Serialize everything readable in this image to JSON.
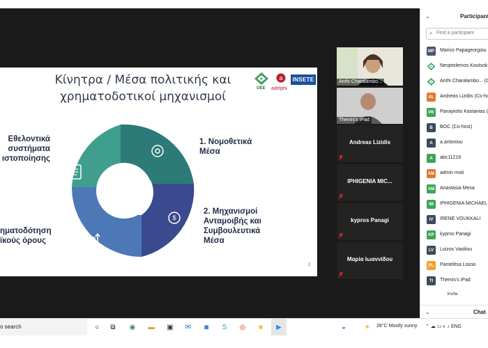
{
  "slide": {
    "title_line1": "Κίνητρα / Μέσα πολιτικής και",
    "title_line2": "χρηματοδοτικοί μηχανισμοί",
    "logos": {
      "oee": "OEE",
      "adelphi": "adelphi",
      "insete": "INSETE"
    },
    "labels": {
      "left_top": [
        "Εθελοντικά",
        "συστήματα",
        "ιστοποίησης"
      ],
      "left_bottom": [
        "ηματοδότηση",
        "ϊκούς όρους"
      ],
      "right_1": [
        "1. Νομοθετικά",
        "Μέσα"
      ],
      "right_2": [
        "2. Μηχανισμοί",
        "Ανταμοιβής και",
        "Συμβουλευτικά",
        "Μέσα"
      ]
    },
    "page_number": "2",
    "colors": {
      "teal": "#3f9e8c",
      "teal_dark": "#2c7b78",
      "blue": "#4d78b8",
      "navy": "#3b4a8e"
    }
  },
  "videos": [
    {
      "name": "Anthi Charalambo...",
      "kind": "camera-woman"
    },
    {
      "name": "Themis's iPad",
      "kind": "camera-man"
    }
  ],
  "name_tiles": [
    "Andreas Lizidis",
    "IPHIGENIA MIC...",
    "kypros Panagi",
    "Μαρία Ιωαννίδου"
  ],
  "participants_panel": {
    "title": "Participants",
    "search_placeholder": "Find a participant",
    "participants": [
      {
        "initials": "MP",
        "name": "Marios Papageorgiou",
        "color": "#4a5568",
        "logo": false
      },
      {
        "initials": "",
        "name": "Neoptolemos Koutsok",
        "color": "#3f9e5a",
        "logo": true
      },
      {
        "initials": "",
        "name": "Anthi Charalambo... (C",
        "color": "#3f9e5a",
        "logo": true
      },
      {
        "initials": "AL",
        "name": "Andreas Lizidis (Co-ho",
        "color": "#e07a2f",
        "logo": false
      },
      {
        "initials": "PK",
        "name": "Panayiotis Kastanias (C",
        "color": "#3fa45a",
        "logo": false
      },
      {
        "initials": "B",
        "name": "BOC (Co-host)",
        "color": "#3c4a5a",
        "logo": false
      },
      {
        "initials": "A",
        "name": "a.antoniou",
        "color": "#3c4a5a",
        "logo": false
      },
      {
        "initials": "A",
        "name": "abc11216",
        "color": "#3fa45a",
        "logo": false
      },
      {
        "initials": "AM",
        "name": "admin moit",
        "color": "#e07a2f",
        "logo": false
      },
      {
        "initials": "AM",
        "name": "Anastasia Mexa",
        "color": "#3fa45a",
        "logo": false
      },
      {
        "initials": "IM",
        "name": "IPHIGENIA MICHAEL",
        "color": "#3fa45a",
        "logo": false
      },
      {
        "initials": "IV",
        "name": "IRENE VOUKKALI",
        "color": "#3c4a5a",
        "logo": false
      },
      {
        "initials": "KP",
        "name": "kypros Panagi",
        "color": "#3fa45a",
        "logo": false
      },
      {
        "initials": "LV",
        "name": "Loizos Vasiliou",
        "color": "#3c4a5a",
        "logo": false
      },
      {
        "initials": "PL",
        "name": "Pantelitsa Loizia",
        "color": "#f0a22a",
        "logo": false
      },
      {
        "initials": "TI",
        "name": "Themis's iPad",
        "color": "#3c4a5a",
        "logo": false
      }
    ],
    "invite_label": "Invite",
    "chat_title": "Chat"
  },
  "taskbar": {
    "search_text": "o search",
    "weather": "28°C  Mostly sunny",
    "tray_text": "ENG"
  }
}
